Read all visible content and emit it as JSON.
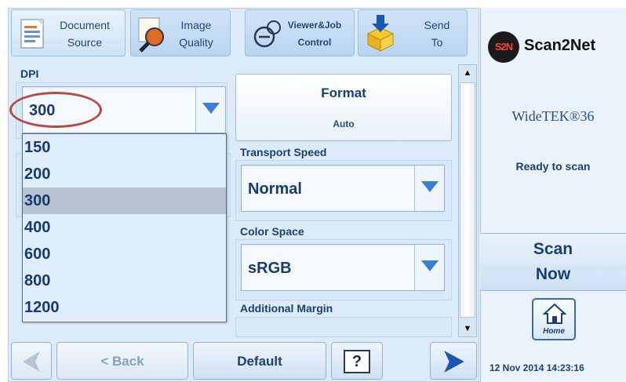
{
  "tabs": [
    {
      "line1": "Document",
      "line2": "Source",
      "icon": "document-icon"
    },
    {
      "line1": "Image",
      "line2": "Quality",
      "icon": "magnifier-icon"
    },
    {
      "line1": "Viewer&Job",
      "line2": "Control",
      "icon": "viewer-icon"
    },
    {
      "line1": "Send",
      "line2": "To",
      "icon": "send-box-icon"
    }
  ],
  "dpi": {
    "label": "DPI",
    "value": "300",
    "options": [
      "150",
      "200",
      "300",
      "400",
      "600",
      "800",
      "1200"
    ],
    "selected_index": 2
  },
  "format": {
    "label": "Format",
    "value": "Auto"
  },
  "transport_speed": {
    "label": "Transport Speed",
    "value": "Normal"
  },
  "color_space": {
    "label": "Color Space",
    "value": "sRGB"
  },
  "additional_margin": {
    "label": "Additional Margin"
  },
  "bottom": {
    "back_label": "< Back",
    "default_label": "Default",
    "help_label": "?"
  },
  "right": {
    "logo_badge": "S2N",
    "logo_text": "Scan2Net",
    "model": "WideTEK®36",
    "status": "Ready to scan",
    "scan_line1": "Scan",
    "scan_line2": "Now",
    "home_label": "Home",
    "datetime": "12 Nov 2014 14:23:16"
  },
  "colors": {
    "panel": "#dcebfa",
    "accent": "#1c3f73",
    "arrow": "#1b56b3",
    "highlight": "#b84a45"
  }
}
